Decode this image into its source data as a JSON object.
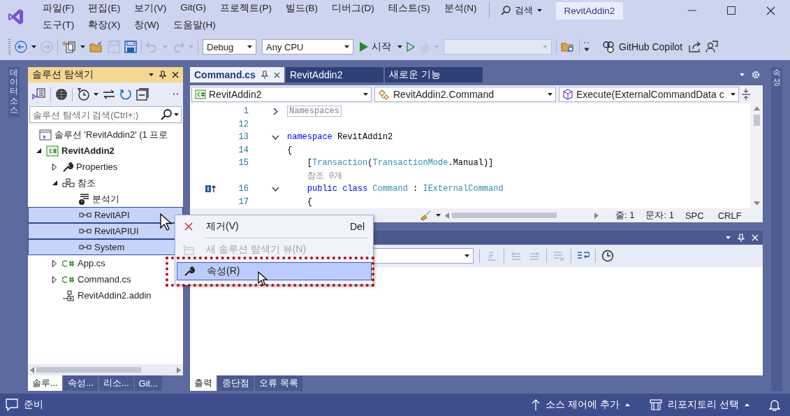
{
  "title_bar": {
    "menu_rows": [
      [
        "파일(F)",
        "편집(E)",
        "보기(V)",
        "Git(G)",
        "프로젝트(P)",
        "빌드(B)",
        "디버그(D)",
        "테스트(S)",
        "분석(N)"
      ],
      [
        "도구(T)",
        "확장(X)",
        "창(W)",
        "도움말(H)"
      ]
    ],
    "search": "검색",
    "solution_name": "RevitAddin2"
  },
  "toolbar": {
    "configuration": "Debug",
    "platform": "Any CPU",
    "start": "시작",
    "copilot": "GitHub Copilot"
  },
  "left_strip": {
    "tab": "데이터 소스"
  },
  "right_strip": {
    "tab": "속성"
  },
  "solution_explorer": {
    "title": "솔루션 탐색기",
    "search": {
      "placeholder": "솔루션 탐색기 검색(Ctrl+;)"
    },
    "tree": [
      {
        "kind": "solution",
        "label": "솔루션 'RevitAddin2' (1 프로",
        "selected": false,
        "children": [
          {
            "kind": "project",
            "label": "RevitAddin2",
            "selected": false,
            "expanded": true,
            "children": [
              {
                "kind": "properties",
                "label": "Properties",
                "selected": false,
                "expanded": false
              },
              {
                "kind": "references",
                "label": "참조",
                "selected": false,
                "expanded": true,
                "children": [
                  {
                    "kind": "analyzers",
                    "label": "분석기",
                    "selected": false
                  },
                  {
                    "kind": "reference",
                    "label": "RevitAPI",
                    "selected": true
                  },
                  {
                    "kind": "reference",
                    "label": "RevitAPIUI",
                    "selected": true
                  },
                  {
                    "kind": "reference",
                    "label": "System",
                    "selected": true
                  }
                ]
              },
              {
                "kind": "csharp",
                "label": "App.cs",
                "selected": false,
                "expanded": false
              },
              {
                "kind": "csharp",
                "label": "Command.cs",
                "selected": false,
                "expanded": false
              },
              {
                "kind": "addin",
                "label": "RevitAddin2.addin",
                "selected": false
              }
            ]
          }
        ]
      }
    ],
    "tabs": [
      {
        "label": "솔루...",
        "selected": true
      },
      {
        "label": "속성...",
        "selected": false
      },
      {
        "label": "리소...",
        "selected": false
      },
      {
        "label": "Git...",
        "selected": false
      }
    ]
  },
  "editor": {
    "tabs": [
      {
        "label": "Command.cs",
        "selected": true
      },
      {
        "label": "RevitAddin2",
        "selected": false
      },
      {
        "label": "새로운 기능",
        "selected": false
      }
    ],
    "navigation": [
      {
        "kind": "project",
        "text": "RevitAddin2"
      },
      {
        "kind": "class",
        "text": "RevitAddin2.Command"
      },
      {
        "kind": "method",
        "text": "Execute(ExternalCommandData c"
      }
    ],
    "code_lines": [
      {
        "number": "1",
        "folded": true,
        "tokens": [
          {
            "kind": "collapsed",
            "text": "Namespaces"
          }
        ]
      },
      {
        "number": "12"
      },
      {
        "number": "13",
        "folded": false,
        "tokens": [
          {
            "kind": "keyword",
            "text": "namespace"
          },
          {
            "kind": "plain",
            "text": " RevitAddin2"
          }
        ]
      },
      {
        "number": "14",
        "tokens": [
          {
            "kind": "plain",
            "text": "{"
          }
        ]
      },
      {
        "number": "15",
        "tokens": [
          {
            "kind": "plain",
            "text": "    ["
          },
          {
            "kind": "type",
            "text": "Transaction"
          },
          {
            "kind": "plain",
            "text": "("
          },
          {
            "kind": "type",
            "text": "TransactionMode"
          },
          {
            "kind": "plain",
            "text": ".Manual)]"
          }
        ]
      },
      {
        "tokens": [
          {
            "kind": "lens",
            "text": "    참조 0개"
          }
        ]
      },
      {
        "number": "16",
        "folded": false,
        "marker": true,
        "tokens": [
          {
            "kind": "keyword",
            "text": "    public class "
          },
          {
            "kind": "type",
            "text": "Command"
          },
          {
            "kind": "plain",
            "text": " : "
          },
          {
            "kind": "type",
            "text": "IExternalCommand"
          }
        ]
      },
      {
        "number": "17",
        "tokens": [
          {
            "kind": "plain",
            "text": "    {"
          }
        ]
      }
    ],
    "status": {
      "line": "줄: 1",
      "column": "문자: 1",
      "spacing": "SPC",
      "line_ending": "CRLF"
    }
  },
  "output_panel": {
    "tabs": [
      {
        "label": "출력",
        "selected": true
      },
      {
        "label": "중단점",
        "selected": false
      },
      {
        "label": "오류 목록",
        "selected": false
      }
    ]
  },
  "context_menu": {
    "items": [
      {
        "kind": "remove",
        "label": "제거(V)",
        "shortcut": "Del",
        "disabled": false,
        "selected": false,
        "separator_after": true
      },
      {
        "kind": "new-view",
        "label": "새 솔루션 탐색기 뷰(N)",
        "disabled": true,
        "selected": false
      },
      {
        "kind": "properties",
        "label": "속성(R)",
        "disabled": false,
        "selected": true
      }
    ]
  },
  "status_bar": {
    "message": "준비",
    "source_control": "소스 제어에 추가",
    "repository": "리포지토리 선택"
  }
}
